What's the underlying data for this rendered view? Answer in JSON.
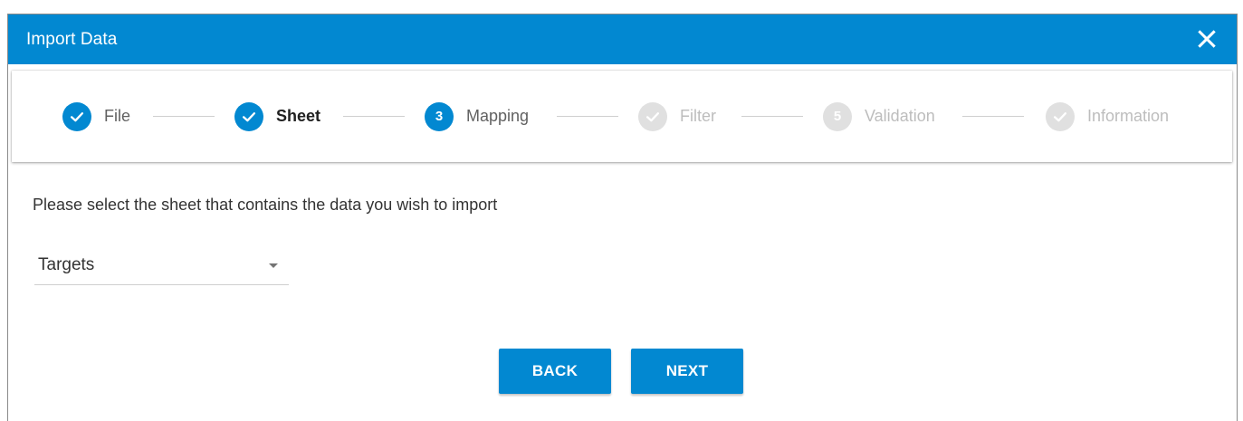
{
  "dialog": {
    "title": "Import Data",
    "close_icon": "close-icon",
    "accent_color": "#0288d1"
  },
  "stepper": {
    "steps": [
      {
        "label": "File",
        "state": "completed",
        "icon": "check-icon"
      },
      {
        "label": "Sheet",
        "state": "completed",
        "icon": "check-icon"
      },
      {
        "label": "Mapping",
        "state": "active",
        "number": "3"
      },
      {
        "label": "Filter",
        "state": "pending",
        "icon": "check-icon"
      },
      {
        "label": "Validation",
        "state": "pending",
        "number": "5"
      },
      {
        "label": "Information",
        "state": "pending",
        "icon": "check-icon"
      }
    ]
  },
  "content": {
    "prompt": "Please select the sheet that contains the data you wish to import",
    "sheet_select": {
      "selected": "Targets",
      "icon": "caret-down-icon"
    }
  },
  "actions": {
    "back_label": "BACK",
    "next_label": "NEXT"
  }
}
